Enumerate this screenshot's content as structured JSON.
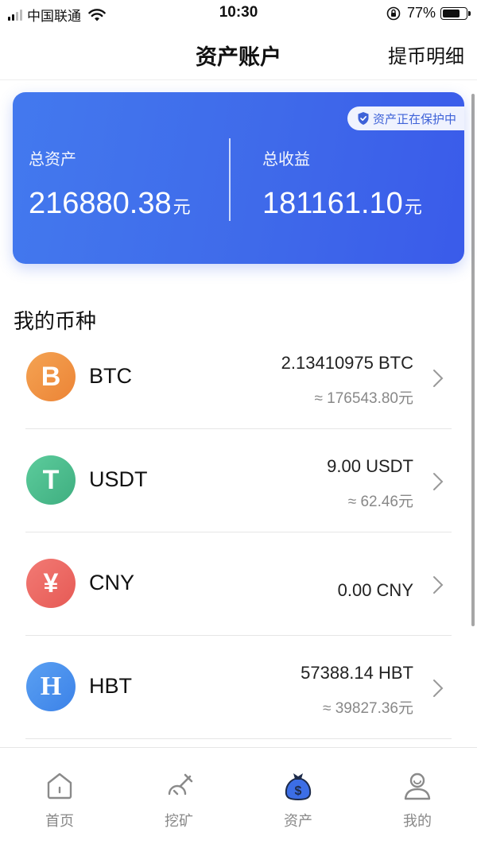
{
  "status_bar": {
    "carrier": "中国联通",
    "time": "10:30",
    "battery": "77%",
    "battery_level": 0.77
  },
  "nav": {
    "title": "资产账户",
    "action": "提币明细"
  },
  "card": {
    "badge": "资产正在保护中",
    "total_assets_label": "总资产",
    "total_assets_value": "216880.38",
    "total_assets_unit": "元",
    "total_income_label": "总收益",
    "total_income_value": "181161.10",
    "total_income_unit": "元"
  },
  "section_title": "我的币种",
  "coins": [
    {
      "symbol": "BTC",
      "icon_glyph": "B",
      "amount": "2.13410975 BTC",
      "fiat": "≈ 176543.80元",
      "color": "#f0923f"
    },
    {
      "symbol": "USDT",
      "icon_glyph": "T",
      "amount": "9.00 USDT",
      "fiat": "≈ 62.46元",
      "color": "#4fbf8f"
    },
    {
      "symbol": "CNY",
      "icon_glyph": "¥",
      "amount": "0.00 CNY",
      "fiat": "",
      "color": "#ee6b66"
    },
    {
      "symbol": "HBT",
      "icon_glyph": "H",
      "amount": "57388.14 HBT",
      "fiat": "≈ 39827.36元",
      "color": "#4b90ee"
    }
  ],
  "tabs": [
    {
      "label": "首页",
      "icon": "home-icon"
    },
    {
      "label": "挖矿",
      "icon": "pickaxe-icon"
    },
    {
      "label": "资产",
      "icon": "money-bag-icon",
      "active": true
    },
    {
      "label": "我的",
      "icon": "user-icon"
    }
  ],
  "colors": {
    "card_gradient_start": "#4379ee",
    "card_gradient_end": "#3a5bea",
    "tab_active": "#3c6ee6"
  }
}
